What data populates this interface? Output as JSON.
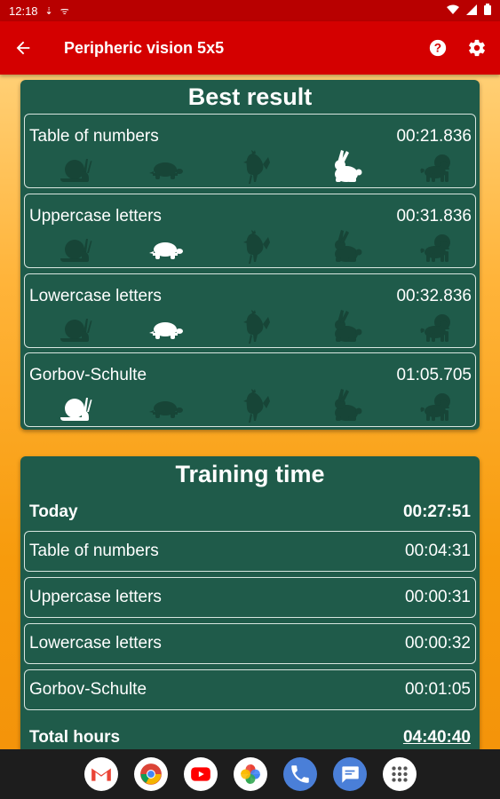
{
  "status_bar": {
    "time": "12:18",
    "left_icons": [
      "usb-icon",
      "wifi-hotspot-icon"
    ],
    "right_icons": [
      "wifi-icon",
      "signal-icon",
      "battery-icon"
    ]
  },
  "app_bar": {
    "title": "Peripheric vision 5x5",
    "back_icon": "arrow-left-icon",
    "help_icon": "help-icon",
    "settings_icon": "gear-icon",
    "color": "#d40000"
  },
  "best_result": {
    "title": "Best result",
    "animal_order": [
      "snail",
      "turtle",
      "rooster",
      "rabbit",
      "lion"
    ],
    "rows": [
      {
        "label": "Table of numbers",
        "time": "00:21.836",
        "highlight": "rabbit"
      },
      {
        "label": "Uppercase letters",
        "time": "00:31.836",
        "highlight": "turtle"
      },
      {
        "label": "Lowercase letters",
        "time": "00:32.836",
        "highlight": "turtle"
      },
      {
        "label": "Gorbov-Schulte",
        "time": "01:05.705",
        "highlight": "snail"
      }
    ]
  },
  "training_time": {
    "title": "Training time",
    "today_label": "Today",
    "today_value": "00:27:51",
    "rows": [
      {
        "label": "Table of numbers",
        "time": "00:04:31"
      },
      {
        "label": "Uppercase letters",
        "time": "00:00:31"
      },
      {
        "label": "Lowercase letters",
        "time": "00:00:32"
      },
      {
        "label": "Gorbov-Schulte",
        "time": "00:01:05"
      }
    ],
    "total_label": "Total hours",
    "total_value": "04:40:40"
  },
  "dock": [
    "gmail-icon",
    "chrome-icon",
    "youtube-icon",
    "photos-icon",
    "phone-icon",
    "messages-icon",
    "apps-icon"
  ],
  "colors": {
    "card": "#1f5b4a",
    "card_border": "#d8e6e0",
    "animal_dim": "#174537",
    "animal_active": "#ffffff"
  }
}
